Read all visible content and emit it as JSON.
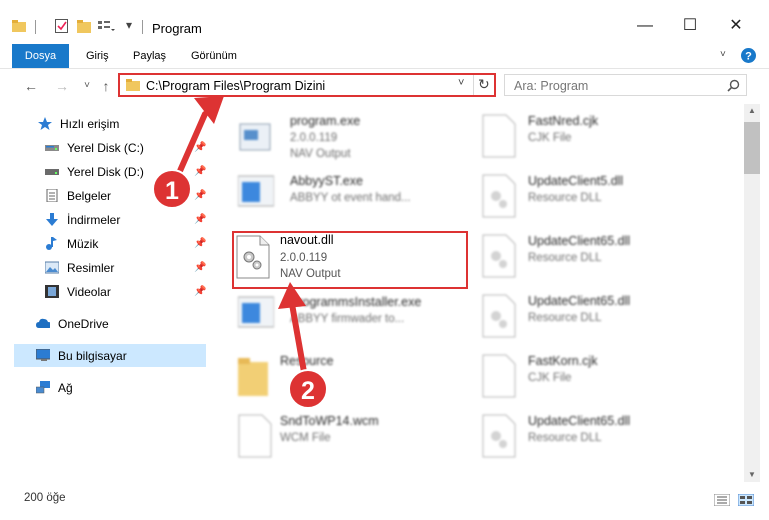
{
  "window": {
    "title": "Program"
  },
  "ribbon": {
    "tabs": [
      "Dosya",
      "Giriş",
      "Paylaş",
      "Görünüm"
    ]
  },
  "address": {
    "path": "C:\\Program Files\\Program Dizini"
  },
  "search": {
    "placeholder": "Ara: Program"
  },
  "sidebar": {
    "items": [
      {
        "label": "Hızlı erişim",
        "icon": "star-icon"
      },
      {
        "label": "Yerel Disk (C:)",
        "icon": "drive-icon"
      },
      {
        "label": "Yerel Disk (D:)",
        "icon": "drive-icon"
      },
      {
        "label": "Belgeler",
        "icon": "documents-icon"
      },
      {
        "label": "İndirmeler",
        "icon": "download-icon"
      },
      {
        "label": "Müzik",
        "icon": "music-icon"
      },
      {
        "label": "Resimler",
        "icon": "pictures-icon"
      },
      {
        "label": "Videolar",
        "icon": "videos-icon"
      },
      {
        "label": "OneDrive",
        "icon": "cloud-icon"
      },
      {
        "label": "Bu bilgisayar",
        "icon": "computer-icon"
      },
      {
        "label": "Ağ",
        "icon": "network-icon"
      }
    ]
  },
  "files_left": [
    {
      "name": "program.exe",
      "line2": "2.0.0.119",
      "line3": "NAV Output"
    },
    {
      "name": "AbbyyST.exe",
      "line2": "ABBYY ot event hand...",
      "line3": ""
    },
    {
      "name": "navout.dll",
      "line2": "2.0.0.119",
      "line3": "NAV Output"
    },
    {
      "name": "ProgrammsInstaller.exe",
      "line2": "ABBYY firmwader to...",
      "line3": ""
    },
    {
      "name": "Resource",
      "line2": "",
      "line3": ""
    },
    {
      "name": "SndToWP14.wcm",
      "line2": "WCM File",
      "line3": ""
    }
  ],
  "files_right": [
    {
      "name": "FastNred.cjk",
      "line2": "CJK File"
    },
    {
      "name": "UpdateClient5.dll",
      "line2": "Resource DLL"
    },
    {
      "name": "UpdateClient65.dll",
      "line2": "Resource DLL"
    },
    {
      "name": "UpdateClient65.dll",
      "line2": "Resource DLL"
    },
    {
      "name": "FastKorn.cjk",
      "line2": "CJK File"
    },
    {
      "name": "UpdateClient65.dll",
      "line2": "Resource DLL"
    }
  ],
  "status": {
    "count": "200 öğe"
  },
  "annotations": {
    "step1": "1",
    "step2": "2"
  },
  "colors": {
    "accent": "#1979ca",
    "highlight": "#d33333",
    "selected": "#cce8ff"
  }
}
